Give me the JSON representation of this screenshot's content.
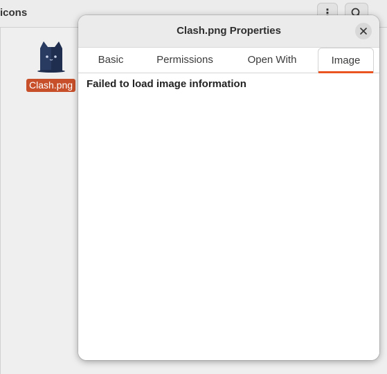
{
  "background_window": {
    "title_fragment": "icons",
    "menu_icon": "vertical-dots-icon",
    "search_icon": "search-icon",
    "file": {
      "name": "Clash.png",
      "icon": "clash-cat-icon"
    }
  },
  "dialog": {
    "title": "Clash.png Properties",
    "close_icon": "close-icon",
    "tabs": [
      {
        "label": "Basic",
        "active": false
      },
      {
        "label": "Permissions",
        "active": false
      },
      {
        "label": "Open With",
        "active": false
      },
      {
        "label": "Image",
        "active": true
      }
    ],
    "message": "Failed to load image information"
  },
  "colors": {
    "accent": "#e95420",
    "selection": "#c7502a",
    "dialog_bg": "#ffffff",
    "titlebar_bg": "#ebebeb"
  }
}
